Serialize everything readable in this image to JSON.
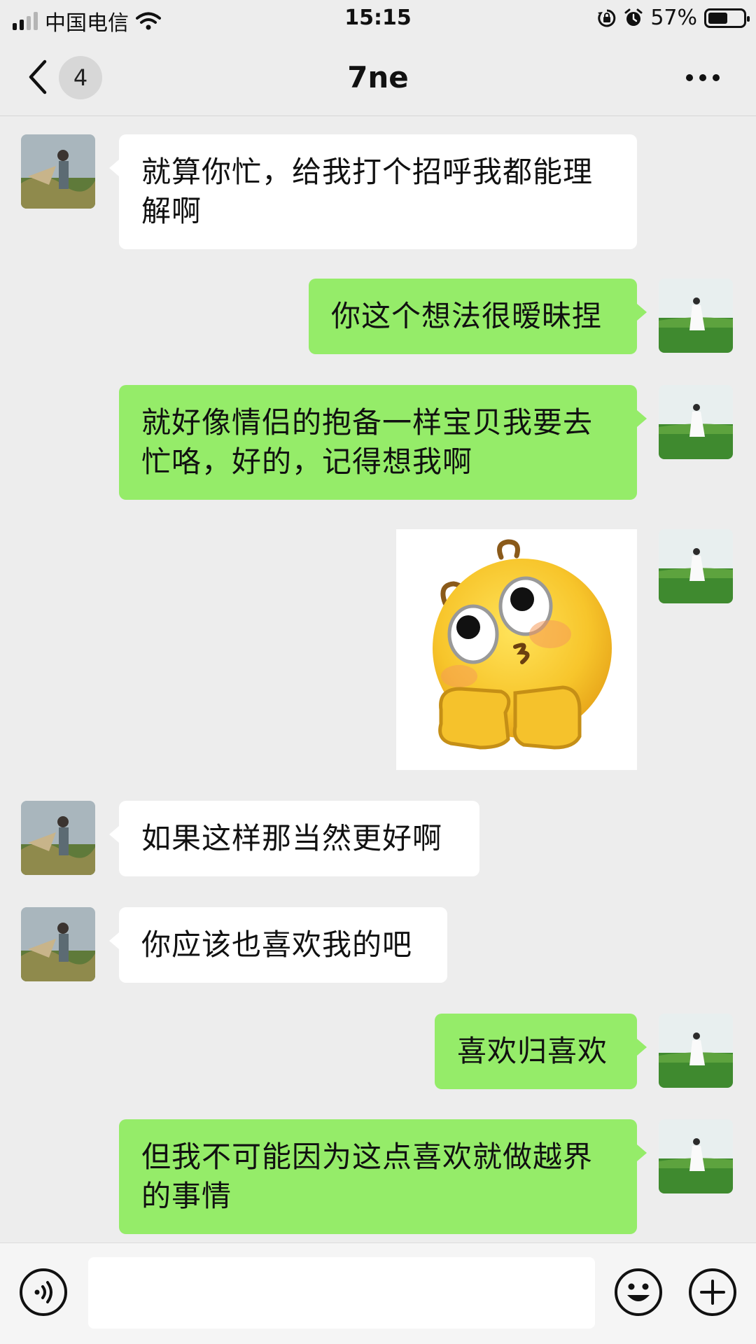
{
  "status_bar": {
    "carrier": "中国电信",
    "time": "15:15",
    "battery_percent": "57%",
    "battery_level": 0.57,
    "icons": [
      "signal-icon",
      "wifi-icon",
      "orientation-lock-icon",
      "alarm-icon",
      "battery-icon"
    ]
  },
  "nav": {
    "back_icon": "chevron-left-icon",
    "unread_count": "4",
    "title": "7ne",
    "more_icon": "more-dots-icon"
  },
  "messages": [
    {
      "side": "left",
      "type": "text",
      "text": "就算你忙，给我打个招呼我都能理解啊"
    },
    {
      "side": "right",
      "type": "text",
      "text": "你这个想法很暧昧捏"
    },
    {
      "side": "right",
      "type": "text",
      "text": "就好像情侣的抱备一样宝贝我要去忙咯，好的，记得想我啊"
    },
    {
      "side": "right",
      "type": "sticker",
      "sticker": "emoji-pleading-face-sticker"
    },
    {
      "side": "left",
      "type": "text",
      "text": "如果这样那当然更好啊"
    },
    {
      "side": "left",
      "type": "text",
      "text": "你应该也喜欢我的吧"
    },
    {
      "side": "right",
      "type": "text",
      "text": "喜欢归喜欢"
    },
    {
      "side": "right",
      "type": "text",
      "text": "但我不可能因为这点喜欢就做越界的事情"
    }
  ],
  "input_bar": {
    "voice_icon": "voice-icon",
    "input_value": "",
    "emoji_icon": "smiley-icon",
    "plus_icon": "plus-icon"
  },
  "colors": {
    "background": "#ededed",
    "bubble_self": "#95ec69",
    "bubble_other": "#ffffff"
  }
}
